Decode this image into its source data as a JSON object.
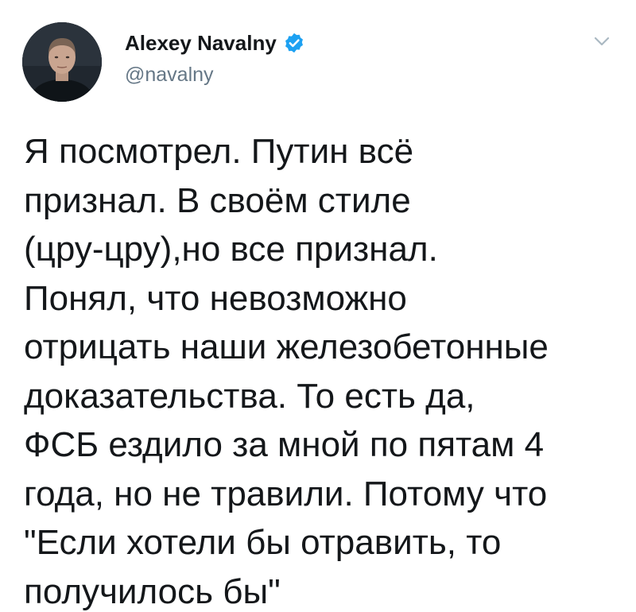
{
  "tweet": {
    "author": {
      "display_name": "Alexey Navalny",
      "handle": "@navalny",
      "verified": true,
      "verified_icon": "verified-badge-icon",
      "avatar_icon": "avatar-photo"
    },
    "caret_icon": "chevron-down-icon",
    "text_lines": [
      "Я посмотрел. Путин всё",
      "признал. В своём стиле",
      "(цру-цру),но все признал.",
      "Понял, что невозможно",
      "отрицать наши железобетонные",
      "доказательства. То есть да,",
      "ФСБ ездило за мной по пятам 4",
      "года, но не травили. Потому что",
      "\"Если хотели бы отравить, то",
      "получилось бы\""
    ]
  },
  "colors": {
    "verified_blue": "#1da1f2",
    "text": "#14171a",
    "secondary_text": "#657786",
    "caret": "#aab8c2"
  }
}
